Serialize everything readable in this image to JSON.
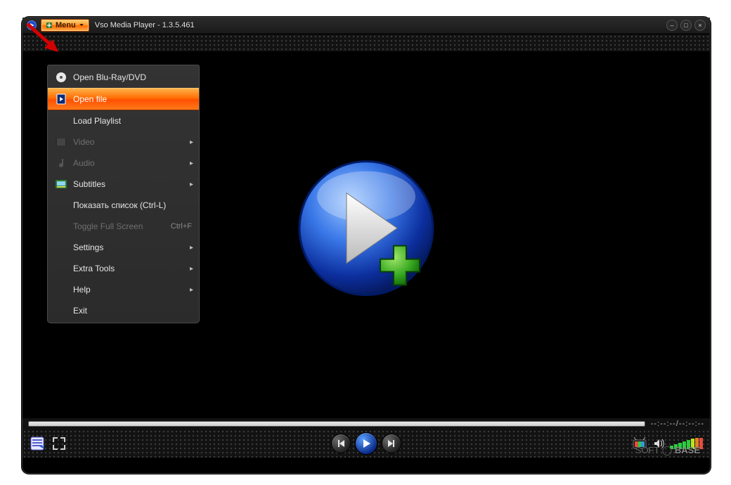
{
  "titlebar": {
    "menu_label": "Menu",
    "app_title": "Vso Media Player - 1.3.5.461"
  },
  "menu": {
    "items": [
      {
        "label": "Open Blu-Ray/DVD",
        "icon": "disc-icon",
        "submenu": false,
        "enabled": true
      },
      {
        "label": "Open file",
        "icon": "file-icon",
        "submenu": false,
        "enabled": true,
        "selected": true
      },
      {
        "label": "Load Playlist",
        "icon": "",
        "submenu": false,
        "enabled": true
      },
      {
        "label": "Video",
        "icon": "video-icon",
        "submenu": true,
        "enabled": false
      },
      {
        "label": "Audio",
        "icon": "audio-icon",
        "submenu": true,
        "enabled": false
      },
      {
        "label": "Subtitles",
        "icon": "subtitles-icon",
        "submenu": true,
        "enabled": true
      },
      {
        "label": "Показать список (Ctrl-L)",
        "icon": "",
        "submenu": false,
        "enabled": true
      },
      {
        "label": "Toggle Full Screen",
        "icon": "",
        "submenu": false,
        "enabled": false,
        "shortcut": "Ctrl+F"
      },
      {
        "label": "Settings",
        "icon": "",
        "submenu": true,
        "enabled": true
      },
      {
        "label": "Extra Tools",
        "icon": "",
        "submenu": true,
        "enabled": true
      },
      {
        "label": "Help",
        "icon": "",
        "submenu": true,
        "enabled": true
      },
      {
        "label": "Exit",
        "icon": "",
        "submenu": false,
        "enabled": true
      }
    ]
  },
  "seekbar": {
    "time_display": "--:--:--/--:--:--"
  },
  "watermark": {
    "left": "SOFT",
    "right": "BASE"
  }
}
